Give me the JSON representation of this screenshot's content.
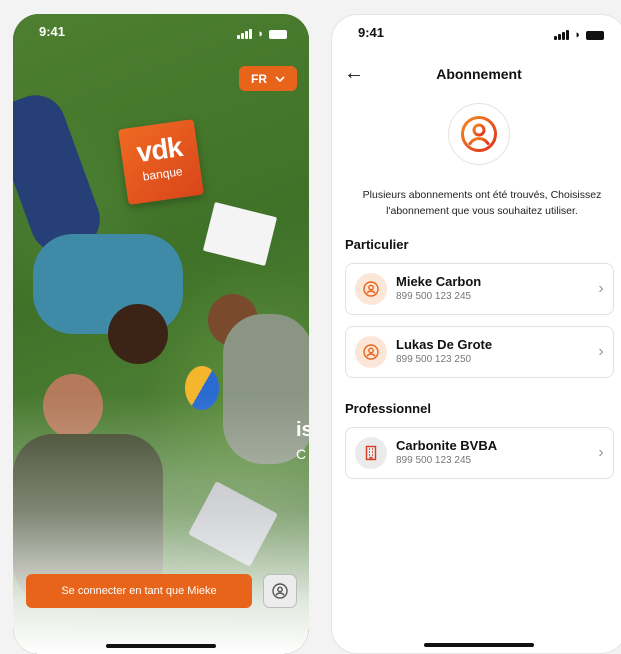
{
  "left_screen": {
    "status_time": "9:41",
    "language": "FR",
    "logo": {
      "word": "vdk",
      "sub": "banque"
    },
    "cta_label": "Se connecter en tant que Mieke",
    "partial_text_1": "is",
    "partial_text_2": "C"
  },
  "right_screen": {
    "status_time": "9:41",
    "title": "Abonnement",
    "intro": "Plusieurs abonnements ont été trouvés, Choisissez l'abonnement que vous souhaitez utiliser.",
    "sections": [
      {
        "title": "Particulier",
        "items": [
          {
            "name": "Mieke Carbon",
            "number": "899 500 123 245",
            "icon": "user-icon"
          },
          {
            "name": "Lukas De Grote",
            "number": "899 500 123 250",
            "icon": "user-icon"
          }
        ]
      },
      {
        "title": "Professionnel",
        "items": [
          {
            "name": "Carbonite BVBA",
            "number": "899 500 123 245",
            "icon": "building-icon"
          }
        ]
      }
    ]
  },
  "colors": {
    "accent": "#e8641b",
    "grass": "#3f7228"
  }
}
